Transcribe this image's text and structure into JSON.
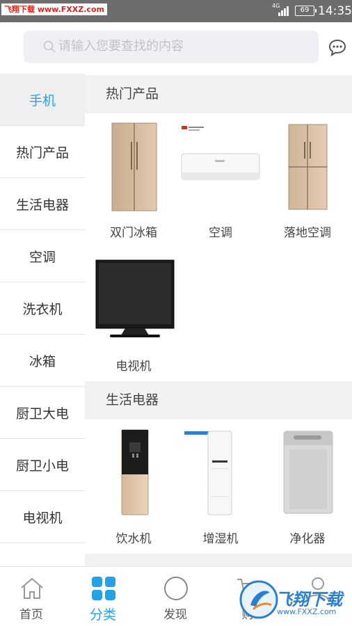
{
  "status_bar": {
    "watermark_tag": "飞翔下载 www.FXXZ.com",
    "network": "4G",
    "battery": "69",
    "time": "14:35"
  },
  "search": {
    "placeholder": "请输入您要查找的内容"
  },
  "categories": [
    {
      "label": "手机",
      "active": true
    },
    {
      "label": "热门产品"
    },
    {
      "label": "生活电器"
    },
    {
      "label": "空调"
    },
    {
      "label": "洗衣机"
    },
    {
      "label": "冰箱"
    },
    {
      "label": "厨卫大电"
    },
    {
      "label": "厨卫小电"
    },
    {
      "label": "电视机"
    }
  ],
  "sections": [
    {
      "title": "热门产品",
      "products": [
        {
          "name": "双门冰箱",
          "icon": "double-door-fridge"
        },
        {
          "name": "空调",
          "icon": "wall-air-conditioner"
        },
        {
          "name": "落地空调",
          "icon": "four-door-fridge"
        },
        {
          "name": "电视机",
          "icon": "television"
        }
      ]
    },
    {
      "title": "生活电器",
      "products": [
        {
          "name": "饮水机",
          "icon": "water-dispenser"
        },
        {
          "name": "增湿机",
          "icon": "floor-air-conditioner"
        },
        {
          "name": "净化器",
          "icon": "washing-machine"
        }
      ]
    }
  ],
  "tabbar": [
    {
      "label": "首页",
      "icon": "home-icon"
    },
    {
      "label": "分类",
      "icon": "category-grid-icon",
      "active": true
    },
    {
      "label": "发现",
      "icon": "compass-icon"
    },
    {
      "label": "购",
      "icon": "cart-icon"
    },
    {
      "label": "",
      "icon": "user-icon"
    }
  ],
  "watermark": {
    "brand": "飞翔下载",
    "url": "www.FXXZ.com"
  },
  "colors": {
    "accent": "#23a3e6",
    "status_bar": "#6d6d6d",
    "section_bg": "#f2f2f2"
  }
}
